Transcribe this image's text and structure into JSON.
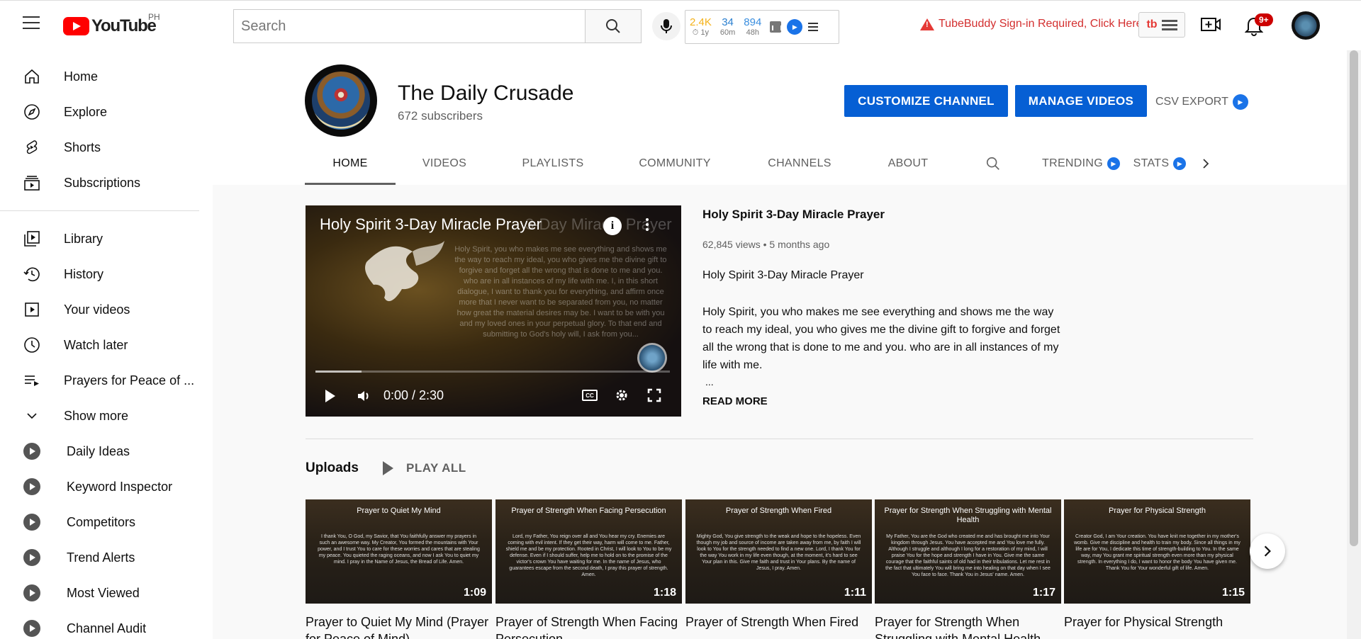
{
  "topbar": {
    "logo_text": "YouTube",
    "country_code": "PH",
    "search_placeholder": "Search",
    "tubebuddy_stats": [
      {
        "value": "2.4K",
        "label": "1y",
        "color": "#f5b21a"
      },
      {
        "value": "34",
        "label": "60m",
        "color": "#2a7fcf"
      },
      {
        "value": "894",
        "label": "48h",
        "color": "#3a8edf"
      }
    ],
    "alert_text": "TubeBuddy Sign-in Required, Click Here",
    "tb_logo": "tb",
    "notifications": "9+"
  },
  "sidebar": {
    "primary": [
      {
        "label": "Home",
        "icon": "home-icon"
      },
      {
        "label": "Explore",
        "icon": "compass-icon"
      },
      {
        "label": "Shorts",
        "icon": "shorts-icon"
      },
      {
        "label": "Subscriptions",
        "icon": "subscriptions-icon"
      }
    ],
    "secondary": [
      {
        "label": "Library",
        "icon": "library-icon"
      },
      {
        "label": "History",
        "icon": "history-icon"
      },
      {
        "label": "Your videos",
        "icon": "your-videos-icon"
      },
      {
        "label": "Watch later",
        "icon": "clock-icon"
      },
      {
        "label": "Prayers for Peace of ...",
        "icon": "playlist-icon"
      },
      {
        "label": "Show more",
        "icon": "chevron-down-icon"
      }
    ],
    "extensions": [
      {
        "label": "Daily Ideas"
      },
      {
        "label": "Keyword Inspector"
      },
      {
        "label": "Competitors"
      },
      {
        "label": "Trend Alerts"
      },
      {
        "label": "Most Viewed"
      },
      {
        "label": "Channel Audit"
      }
    ]
  },
  "channel": {
    "name": "The Daily Crusade",
    "subscribers": "672 subscribers",
    "customize_label": "CUSTOMIZE CHANNEL",
    "manage_label": "MANAGE VIDEOS",
    "csv_label": "CSV EXPORT",
    "tabs": [
      "HOME",
      "VIDEOS",
      "PLAYLISTS",
      "COMMUNITY",
      "CHANNELS",
      "ABOUT"
    ],
    "extra_tabs": [
      "TRENDING",
      "STATS"
    ]
  },
  "featured": {
    "video_title": "Holy Spirit 3-Day Miracle Prayer",
    "video_title_ghost": "3-Day Miracle Prayer",
    "overlay_text": "Holy Spirit, you who makes me see everything and shows me the way to reach my ideal, you who gives me the divine gift to forgive and forget all the wrong that is done to me and you. who are in all instances of my life with me. I, in this short dialogue, I want to thank you for everything, and affirm once more that I never want to be separated from you, no matter how great the material desires may be. I want to be with you and my loved ones in your perpetual glory. To that end and submitting to God's holy will, I ask from you...",
    "time": "0:00 / 2:30",
    "watched_fraction": 0.0,
    "buffered_fraction": 0.13,
    "title": "Holy Spirit 3-Day Miracle Prayer",
    "views": "62,845 views",
    "age": "5 months ago",
    "desc1": "Holy Spirit 3-Day Miracle Prayer",
    "desc2": "Holy Spirit, you who makes me see everything and shows me the way to reach my ideal, you who gives me the divine gift to forgive and forget all the wrong that is done to me and you. who are in all instances of my life with me.",
    "ellipsis": "...",
    "read_more": "READ MORE"
  },
  "uploads": {
    "label": "Uploads",
    "play_all": "PLAY ALL",
    "items": [
      {
        "thumb_title": "Prayer to Quiet My Mind",
        "thumb_text": "I thank You, O God, my Savior, that You faithfully answer my prayers in such an awesome way. My Creator, You formed the mountains with Your power, and I trust You to care for these worries and cares that are stealing my peace. You quieted the raging oceans, and now I ask You to quiet my mind. I pray in the Name of Jesus, the Bread of Life. Amen.",
        "duration": "1:09",
        "title": "Prayer to Quiet My Mind (Prayer for Peace of Mind)"
      },
      {
        "thumb_title": "Prayer of Strength When Facing Persecution",
        "thumb_text": "Lord, my Father, You reign over all and You hear my cry. Enemies are coming with evil intent. If they get their way, harm will come to me. Father, shield me and be my protection. Rooted in Christ, I will look to You to be my defense. Even if I should suffer, help me to hold on to the promise of the victor's crown You have waiting for me. In the name of Jesus, who guarantees escape from the second death, I pray this prayer of strength. Amen.",
        "duration": "1:18",
        "title": "Prayer of Strength When Facing Persecution"
      },
      {
        "thumb_title": "Prayer of Strength When Fired",
        "thumb_text": "Mighty God, You give strength to the weak and hope to the hopeless. Even though my job and source of income are taken away from me, by faith I will look to You for the strength needed to find a new one. Lord, I thank You for the way You work in my life even though, at the moment, it's hard to see Your plan in this. Give me faith and trust in Your plans. By the name of Jesus, I pray. Amen.",
        "duration": "1:11",
        "title": "Prayer of Strength When Fired"
      },
      {
        "thumb_title": "Prayer for Strength When Struggling with Mental Health",
        "thumb_text": "My Father, You are the God who created me and has brought me into Your kingdom through Jesus. You have accepted me and You love me fully. Although I struggle and although I long for a restoration of my mind, I will praise You for the hope and strength I have in You. Give me the same courage that the faithful saints of old had in their tribulations. Let me rest in the fact that ultimately You will bring me into healing on that day when I see You face to face. Thank You in Jesus' name. Amen.",
        "duration": "1:17",
        "title": "Prayer for Strength When Struggling with Mental Health"
      },
      {
        "thumb_title": "Prayer for Physical Strength",
        "thumb_text": "Creator God, I am Your creation. You have knit me together in my mother's womb. Give me discipline and health to train my body. Since all things in my life are for You, I dedicate this time of strength-building to You. In the same way, may You grant me spiritual strength even more than my physical strength. In everything I do, I want to honor the body You have given me. Thank You for Your wonderful gift of life. Amen.",
        "duration": "1:15",
        "title": "Prayer for Physical Strength"
      }
    ]
  },
  "colors": {
    "accent": "#065fd4",
    "brand_red": "#ff0000",
    "alert_red": "#d32f2f"
  }
}
